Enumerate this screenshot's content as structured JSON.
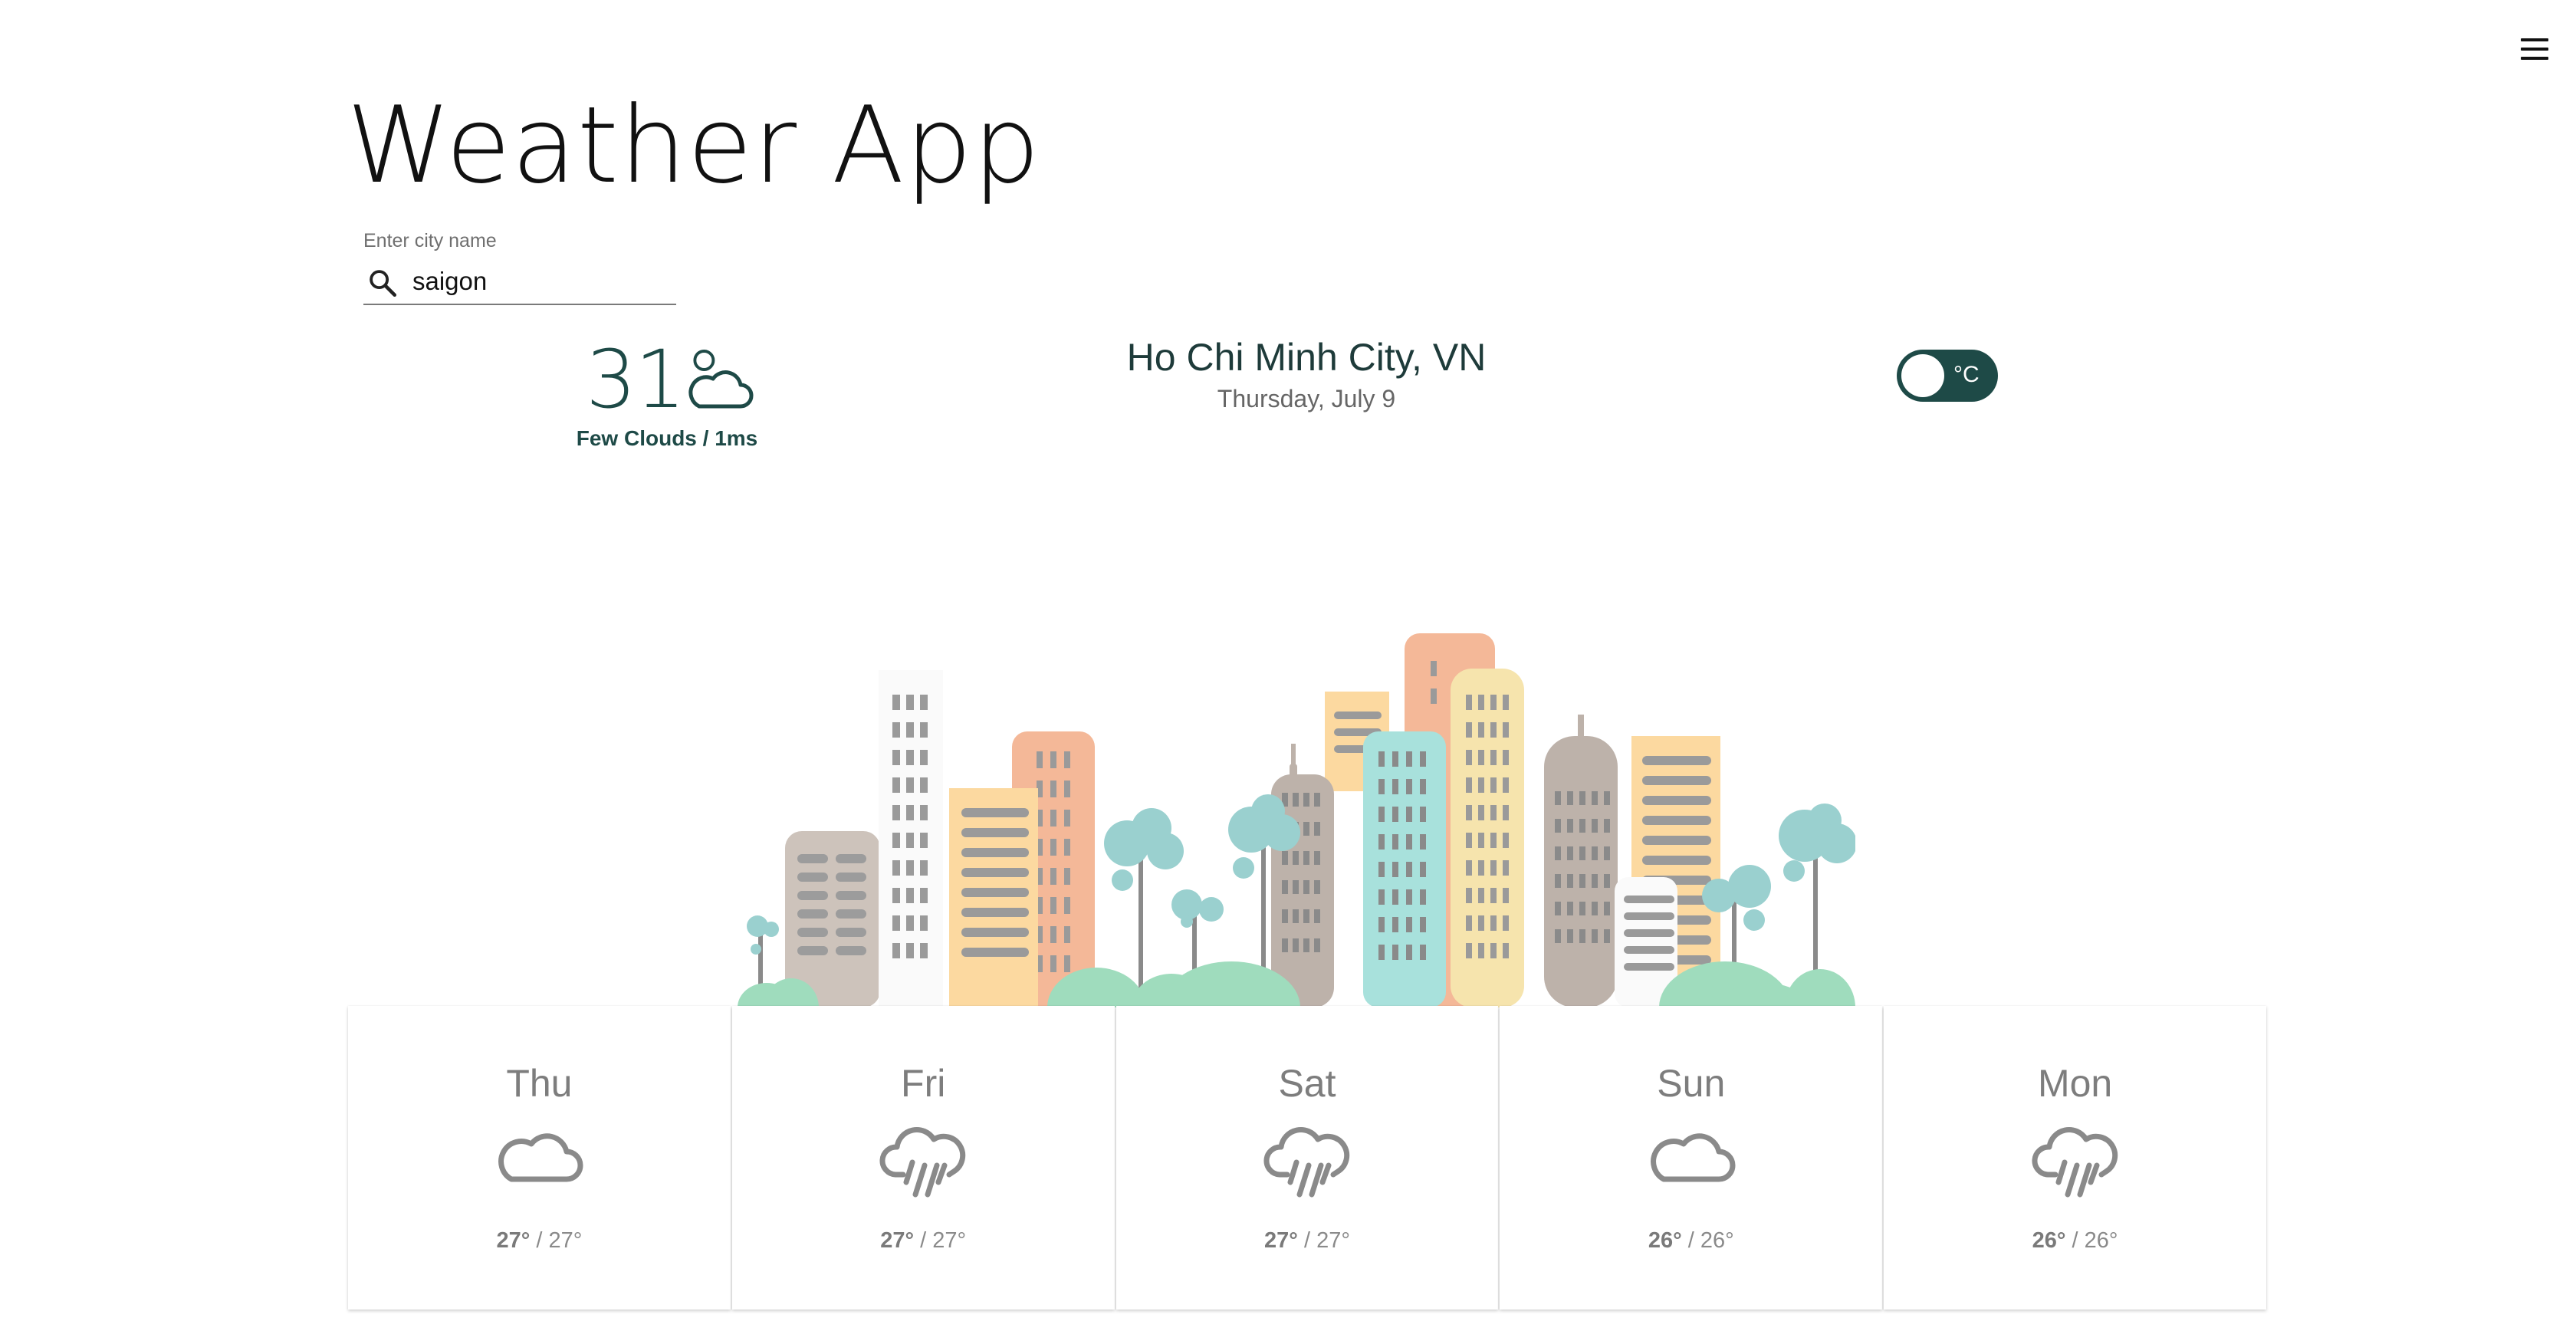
{
  "app": {
    "title": "Weather App"
  },
  "header": {
    "menu_icon": "hamburger-menu-icon"
  },
  "search": {
    "label": "Enter city name",
    "value": "saigon",
    "icon": "search-icon"
  },
  "current": {
    "temperature": "31°",
    "condition_icon": "cloud-icon",
    "condition": "Few Clouds / 1ms"
  },
  "location": {
    "city": "Ho Chi Minh City, VN",
    "date": "Thursday, July 9"
  },
  "unit_toggle": {
    "label": "°C",
    "checked": true
  },
  "illustration": {
    "name": "city-skyline-illustration"
  },
  "forecast": {
    "days": [
      {
        "day": "Thu",
        "icon": "cloud-icon",
        "high": "27°",
        "low": "27°"
      },
      {
        "day": "Fri",
        "icon": "rain-icon",
        "high": "27°",
        "low": "27°"
      },
      {
        "day": "Sat",
        "icon": "rain-icon",
        "high": "27°",
        "low": "27°"
      },
      {
        "day": "Sun",
        "icon": "cloud-icon",
        "high": "26°",
        "low": "26°"
      },
      {
        "day": "Mon",
        "icon": "rain-icon",
        "high": "26°",
        "low": "26°"
      }
    ]
  },
  "colors": {
    "accent": "#1e4a47",
    "text_muted": "#7d7d7d",
    "background": "#ffffff"
  }
}
